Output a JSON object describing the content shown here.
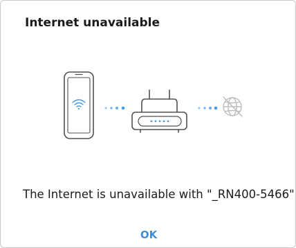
{
  "dialog": {
    "title": "Internet unavailable",
    "message": "The Internet is unavailable with \"_RN400-5466\".",
    "ok_label": "OK"
  },
  "illustration": {
    "icons": [
      "phone-icon",
      "wifi-icon",
      "router-icon",
      "no-internet-globe-icon"
    ]
  },
  "colors": {
    "accent": "#3c8fd7",
    "dots": "#4a9be0",
    "icon_stroke": "#505050",
    "disabled_icon": "#bdbdbd"
  }
}
